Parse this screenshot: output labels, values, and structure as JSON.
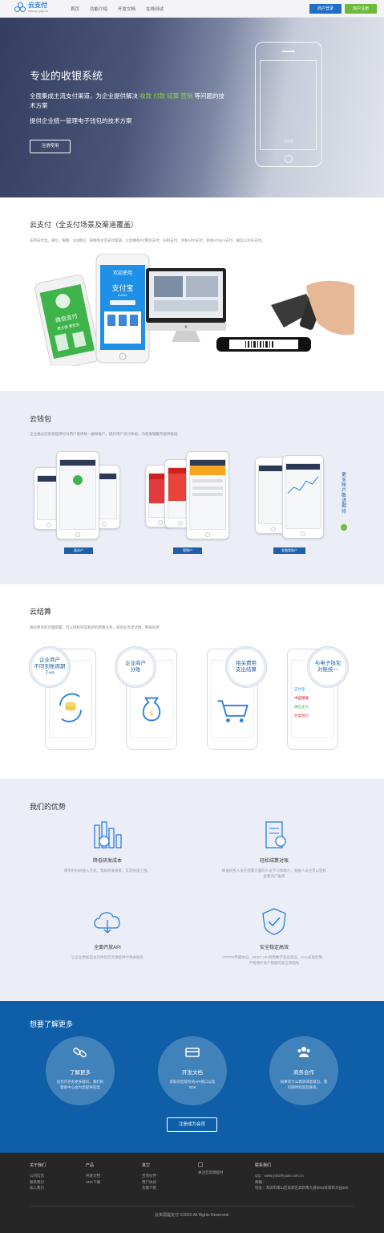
{
  "header": {
    "logo_name": "云支付",
    "logo_url": "www.jc-pay.cn",
    "nav": [
      "首页",
      "功能介绍",
      "开发文档",
      "在线测试"
    ],
    "login_label": "商户登录",
    "register_label": "商户注册"
  },
  "hero": {
    "title": "专业的收银系统",
    "desc_prefix": "全面集成主流支付渠道，为企业提供解决",
    "desc_hl1": "收款",
    "desc_hl2": "付款",
    "desc_hl3": "结算",
    "desc_hl4": "营销",
    "desc_suffix": "等问题的技术方案",
    "subtitle": "提供企业统一管理电子钱包的技术方案",
    "button": "注册使用",
    "phone_slogan": "在这里"
  },
  "section_pay": {
    "title": "云支付（全支付场景及渠道覆盖）",
    "desc": "支持支付宝、微信、银联、QQ钱包、快钱等主流支付渠道，让您拥有PC网页支付、扫码支付、手机APP支付、移动HTML5支付、微信公众号支付。",
    "phone1_text": "微信支付",
    "phone1_sub": "更方便 更安全",
    "phone2_title": "欢迎使用",
    "phone2_brand": "支付宝",
    "phone2_brand_en": "ALIPAY"
  },
  "section_wallet": {
    "title": "云钱包",
    "desc": "企业通过云资源提供付为用户提供统一虚拟账户，提升用户支付体验，为拓展辅服务提供基础",
    "labels": [
      "基本户",
      "营销户",
      "金融类账户"
    ],
    "side_tag": "更多账户 敬请期待",
    "side_dot": "…"
  },
  "section_settle": {
    "title": "云结算",
    "desc": "通过简单的页面配置，可以轻松完成复杂的结算业务，提高业务灵活性，降低投资",
    "circles": [
      {
        "line1": "企业商户",
        "line2": "不同到账周期",
        "line3": "T+n"
      },
      {
        "line1": "企业商户",
        "line2": "分账",
        "line3": ""
      },
      {
        "line1": "相关费用",
        "line2": "支出结算",
        "line3": ""
      },
      {
        "line1": "与电子钱包",
        "line2": "对账统一",
        "line3": ""
      }
    ],
    "wallet_list": [
      "支付宝",
      "中国银联",
      "微信支付",
      "百度钱包"
    ]
  },
  "section_adv": {
    "title": "我们的优势",
    "items": [
      {
        "title": "降低研发成本",
        "desc": "简单的扫码接入方式，帮助开发商家，实现快速上线。"
      },
      {
        "title": "轻松结算对账",
        "desc": "降低财务人员在结算方面的人员学习和精力，商服人员也可以轻松查看商户账目"
      },
      {
        "title": "全面开放API",
        "desc": "让企业更加自主的体验云资源提供付相关服务"
      },
      {
        "title": "安全稳定高效",
        "desc": "HTTPS传输协议、REST API调用数字签名验证、ACL权限控制、严格保护商户数据的安全和隐私"
      }
    ]
  },
  "section_more": {
    "title": "想要了解更多",
    "items": [
      {
        "title": "了解更多",
        "desc": "您也许还有更多疑问，我们的帮助中心会为您提供答案"
      },
      {
        "title": "开发文档",
        "desc": "获取对您现有的API接口以及SDK"
      },
      {
        "title": "商务合作",
        "desc": "如果有什么需求或者意见，我们随时欢迎您联系。"
      }
    ],
    "button": "注册成为会员"
  },
  "footer": {
    "col1": {
      "head": "关于我们",
      "items": [
        "公司信息",
        "联系我们",
        "加入我们"
      ]
    },
    "col2": {
      "head": "产品",
      "items": [
        "开发文档",
        "SDK下载"
      ]
    },
    "col3": {
      "head": "其它",
      "items": [
        "合作伙伴",
        "用户协议",
        "功能介绍"
      ]
    },
    "col4": {
      "head": "关注云资源提付"
    },
    "col5": {
      "head": "联系我们",
      "items": [
        "QQ：www.yunzhiyuan.com.cn",
        "邮箱：",
        "地址：深圳市南山区高新区高新南九道9003号南科大园306"
      ]
    },
    "copyright": "云资源提支付 ©2020 All Rights Reserved."
  }
}
